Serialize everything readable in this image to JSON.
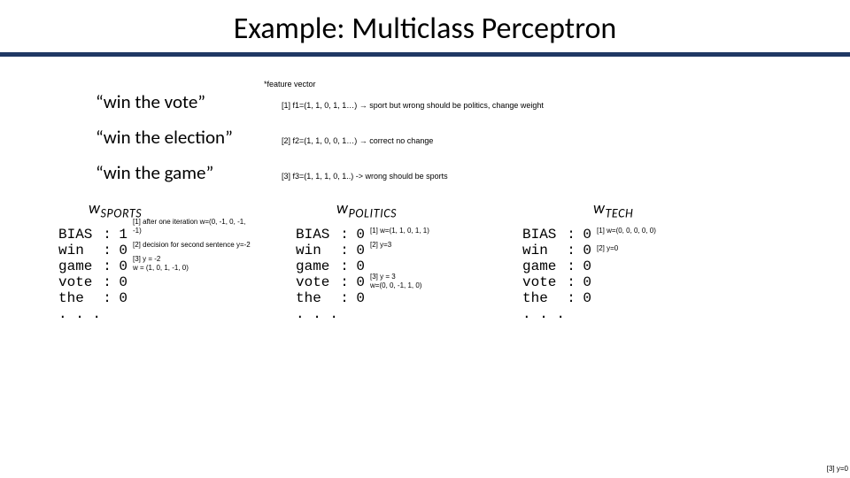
{
  "title": "Example: Multiclass Perceptron",
  "feature_label": "*feature vector",
  "examples": [
    {
      "phrase": "“win the vote”",
      "note": "[1]  f1=(1, 1, 0, 1, 1…) → sport but wrong should be politics, change weight"
    },
    {
      "phrase": "“win the election”",
      "note": "[2] f2=(1, 1, 0, 0, 1…) → correct no change"
    },
    {
      "phrase": "“win the game”",
      "note": "[3] f3=(1, 1, 1, 0, 1..) -> wrong should be sports"
    }
  ],
  "headers": {
    "sports_w": "w",
    "sports_sub": "SPORTS",
    "politics_w": "w",
    "politics_sub": "POLITICS",
    "tech_w": "w",
    "tech_sub": "TECH"
  },
  "row_labels": [
    "BIAS",
    "win",
    "game",
    "vote",
    "the",
    ". . ."
  ],
  "vec_sports": [
    "1",
    "0",
    "0",
    "0",
    "0"
  ],
  "vec_politics": [
    "0",
    "0",
    "0",
    "0",
    "0"
  ],
  "vec_tech": [
    "0",
    "0",
    "0",
    "0",
    "0"
  ],
  "anno_sports": {
    "a": "[1] after one iteration w=(0, -1, 0, -1, -1)",
    "b": "[2] decision for second sentence y=-2",
    "c": "[3] y = -2\nw = (1, 0, 1, -1, 0)"
  },
  "anno_politics": {
    "a": "[1] w=(1, 1, 0, 1, 1)",
    "b": "[2] y=3",
    "c": "[3] y = 3\nw=(0, 0, -1, 1, 0)"
  },
  "anno_tech": {
    "a": "[1] w=(0, 0, 0, 0, 0)",
    "b": "[2] y=0",
    "c": "[3] y=0"
  }
}
